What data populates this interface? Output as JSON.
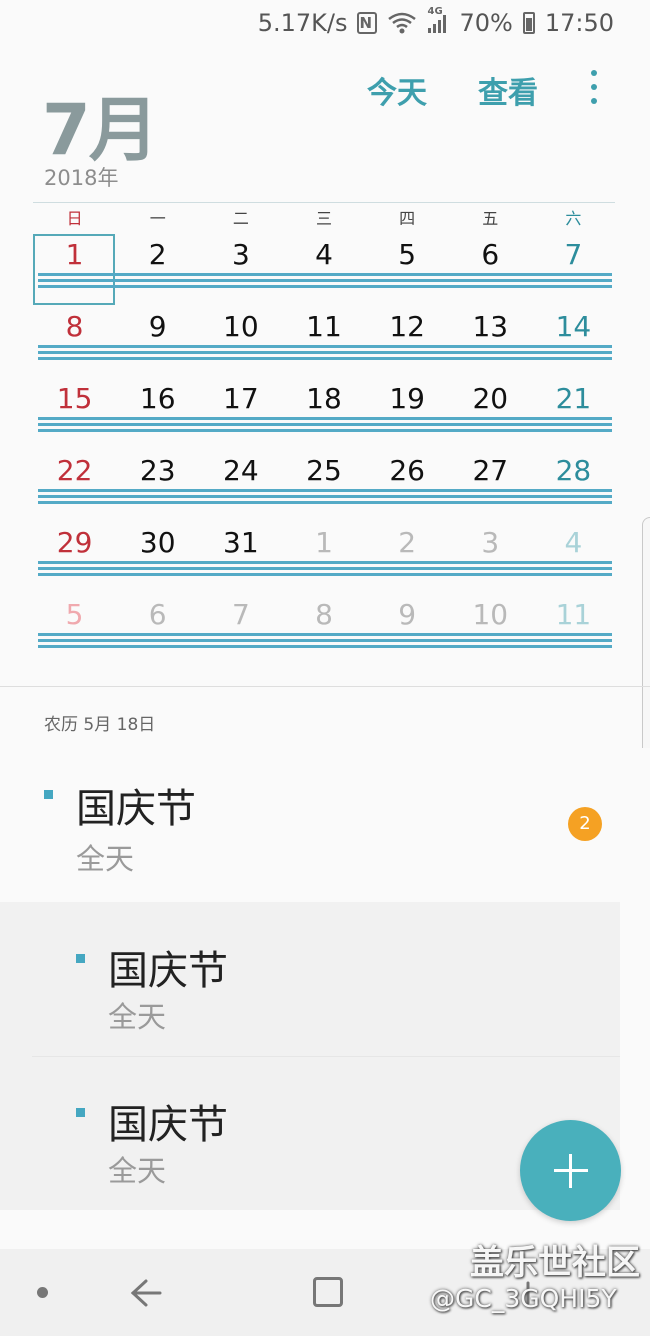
{
  "status_bar": {
    "speed": "5.17K/s",
    "nfc": "N",
    "network": "4G",
    "battery": "70%",
    "time": "17:50"
  },
  "header": {
    "month": "7月",
    "year": "2018年",
    "today_label": "今天",
    "view_label": "查看"
  },
  "calendar": {
    "weekdays": [
      "日",
      "一",
      "二",
      "三",
      "四",
      "五",
      "六"
    ],
    "weeks": [
      [
        "1",
        "2",
        "3",
        "4",
        "5",
        "6",
        "7"
      ],
      [
        "8",
        "9",
        "10",
        "11",
        "12",
        "13",
        "14"
      ],
      [
        "15",
        "16",
        "17",
        "18",
        "19",
        "20",
        "21"
      ],
      [
        "22",
        "23",
        "24",
        "25",
        "26",
        "27",
        "28"
      ],
      [
        "29",
        "30",
        "31",
        "1",
        "2",
        "3",
        "4"
      ],
      [
        "5",
        "6",
        "7",
        "8",
        "9",
        "10",
        "11"
      ]
    ],
    "selected_day": "1"
  },
  "agenda": {
    "lunar_date": "农历 5月 18日",
    "main_event": {
      "title": "国庆节",
      "subtitle": "全天",
      "count": "2"
    },
    "nested_events": [
      {
        "title": "国庆节",
        "subtitle": "全天"
      },
      {
        "title": "国庆节",
        "subtitle": "全天"
      }
    ]
  },
  "watermark": {
    "title": "盖乐世社区",
    "handle": "@GC_3GQHI5Y"
  },
  "colors": {
    "accent": "#3e9fad",
    "sunday": "#c0303a",
    "saturday": "#2d8d9c",
    "event_bar": "#54aac6",
    "badge": "#f5a123",
    "fab": "#49b0bc"
  }
}
